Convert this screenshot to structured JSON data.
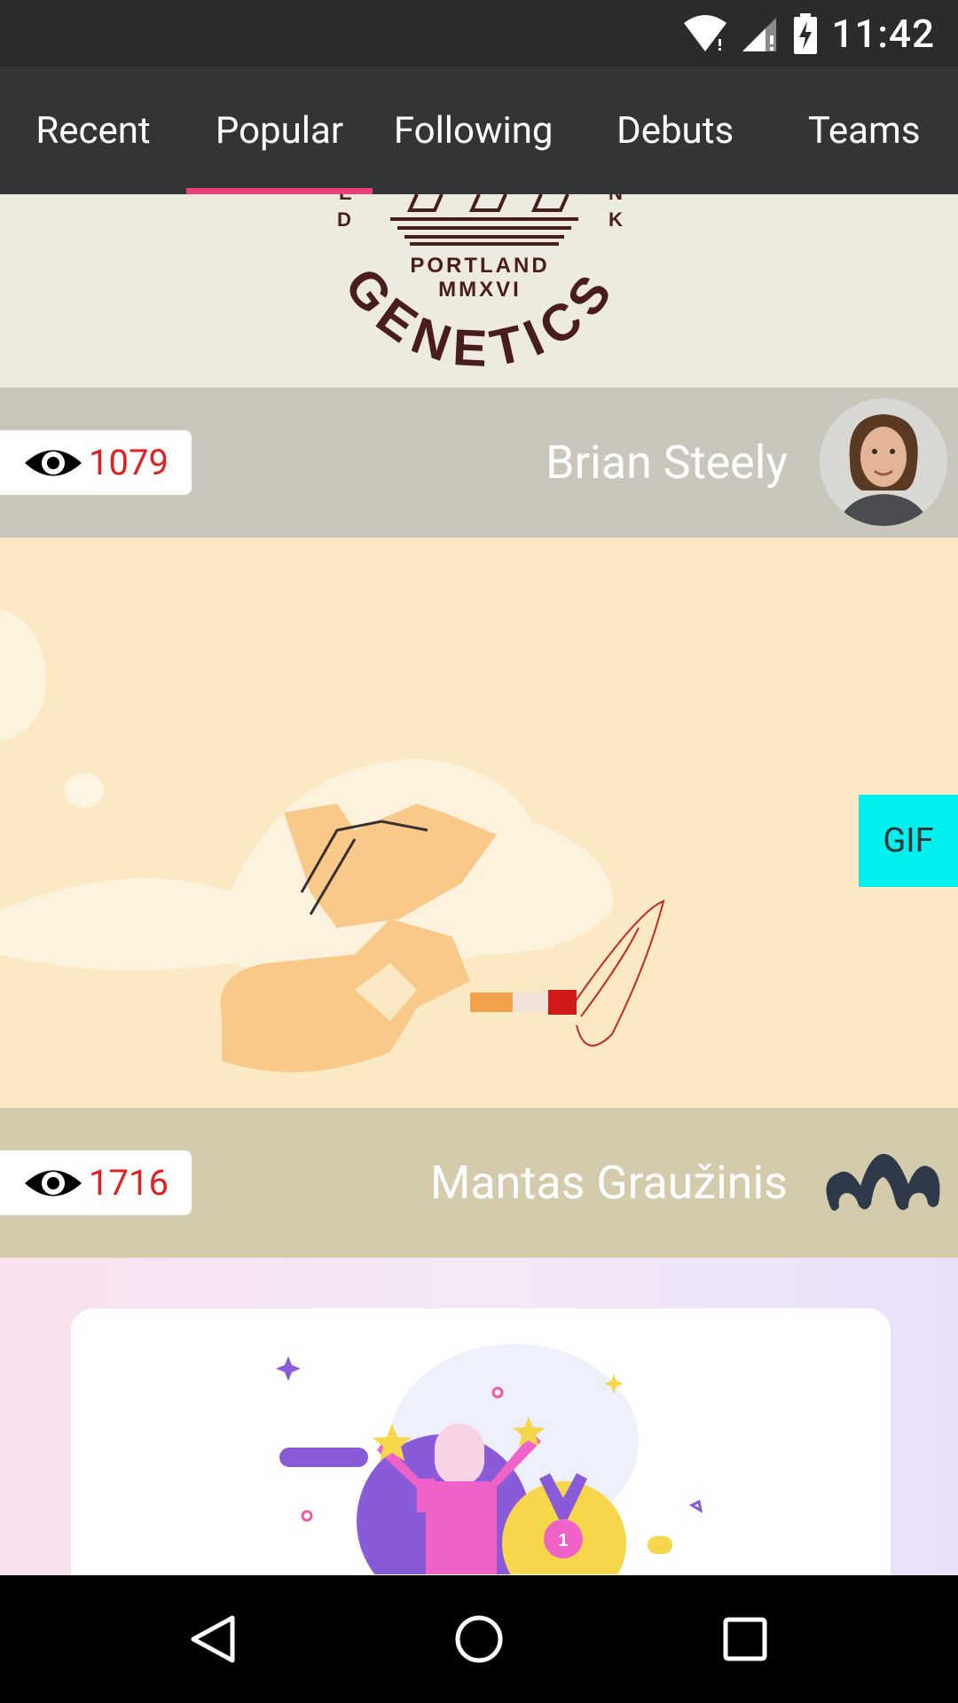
{
  "status_bar": {
    "time": "11:42"
  },
  "tabs": [
    {
      "label": "Recent",
      "active": false
    },
    {
      "label": "Popular",
      "active": true
    },
    {
      "label": "Following",
      "active": false
    },
    {
      "label": "Debuts",
      "active": false
    },
    {
      "label": "Teams",
      "active": false
    }
  ],
  "shots": [
    {
      "logo_text": {
        "line1": "PORTLAND",
        "line2": "MMXVI",
        "arc": "GENETICS",
        "left_letter": "D",
        "left_top": "E",
        "right_letter": "K",
        "right_top": "N"
      },
      "views": "1079",
      "author": "Brian Steely"
    },
    {
      "badge": "GIF",
      "views": "1716",
      "author": "Mantas Graužinis"
    },
    {
      "medal_number": "1"
    }
  ],
  "colors": {
    "accent": "#ec407a",
    "views": "#e02020",
    "gif_badge": "#00f0f0"
  }
}
